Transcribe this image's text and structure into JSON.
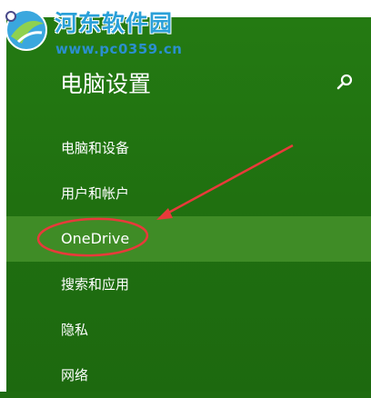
{
  "watermark": {
    "title": "河东软件园",
    "url": "www.pc0359.cn"
  },
  "header": {
    "title": "电脑设置"
  },
  "menu": {
    "items": [
      {
        "label": "电脑和设备"
      },
      {
        "label": "用户和帐户"
      },
      {
        "label": "OneDrive"
      },
      {
        "label": "搜索和应用"
      },
      {
        "label": "隐私"
      },
      {
        "label": "网络"
      }
    ],
    "selected_index": 2
  },
  "colors": {
    "background": "#1f6e10",
    "selected_row": "#3f8c26",
    "annotation": "#e83a3a",
    "text": "#ffffff"
  },
  "icons": {
    "search": "search-icon",
    "watermark_logo": "watermark-logo-icon",
    "settings": "gear-icon"
  }
}
